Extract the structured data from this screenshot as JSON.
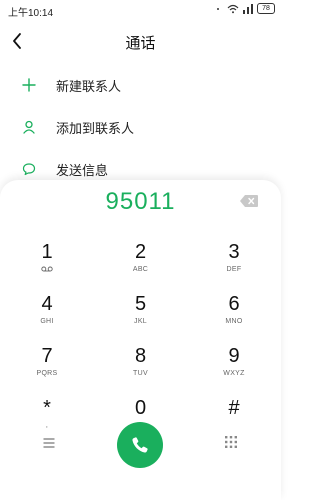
{
  "status": {
    "time": "上午10:14",
    "battery": "78"
  },
  "header": {
    "title": "通话",
    "back_icon": "chevron-left-icon"
  },
  "menu": {
    "items": [
      {
        "label": "新建联系人",
        "icon": "plus-icon"
      },
      {
        "label": "添加到联系人",
        "icon": "person-icon"
      },
      {
        "label": "发送信息",
        "icon": "message-bubble-icon"
      }
    ]
  },
  "dialer": {
    "number": "95011",
    "backspace_icon": "backspace-icon",
    "keys": [
      {
        "digit": "1",
        "sub": ""
      },
      {
        "digit": "2",
        "sub": "ABC"
      },
      {
        "digit": "3",
        "sub": "DEF"
      },
      {
        "digit": "4",
        "sub": "GHI"
      },
      {
        "digit": "5",
        "sub": "JKL"
      },
      {
        "digit": "6",
        "sub": "MNO"
      },
      {
        "digit": "7",
        "sub": "PQRS"
      },
      {
        "digit": "8",
        "sub": "TUV"
      },
      {
        "digit": "9",
        "sub": "WXYZ"
      },
      {
        "digit": "*",
        "sub": ","
      },
      {
        "digit": "0",
        "sub": "+"
      },
      {
        "digit": "#",
        "sub": ""
      }
    ]
  },
  "bottom": {
    "menu_icon": "hamburger-icon",
    "call_icon": "phone-icon",
    "keypad_icon": "dialpad-grid-icon"
  },
  "colors": {
    "accent": "#1aaf5d"
  }
}
